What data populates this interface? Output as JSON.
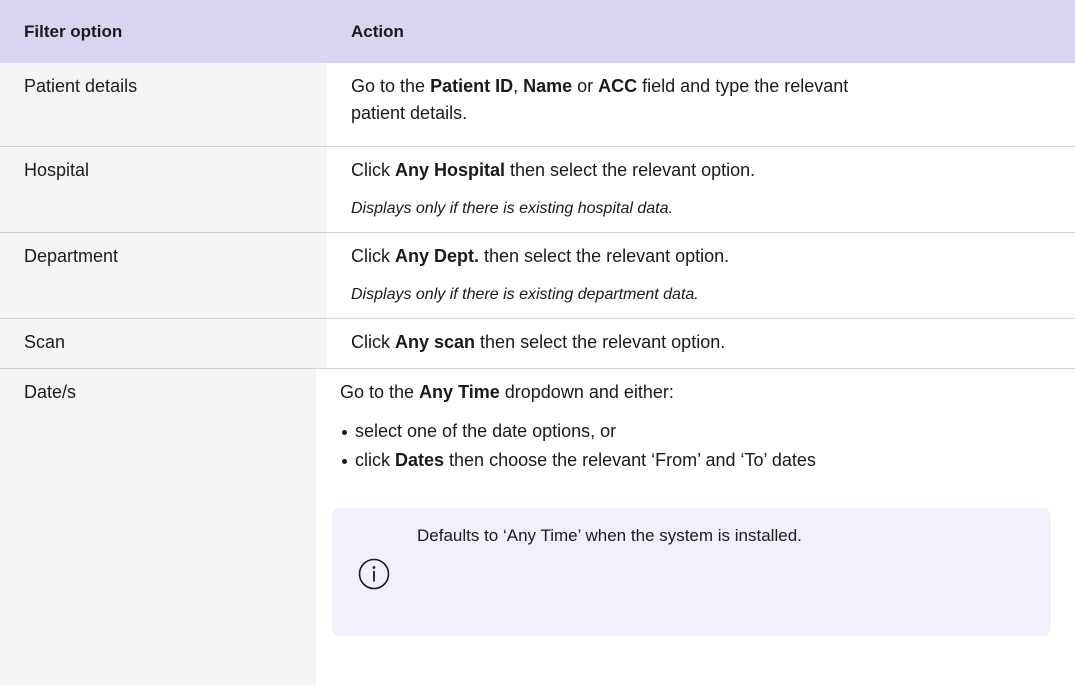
{
  "header": {
    "col1": "Filter option",
    "col2": "Action"
  },
  "rows": {
    "patient": {
      "option": "Patient details",
      "action_pre": "Go to the ",
      "b1": "Patient ID",
      "sep1": ", ",
      "b2": "Name",
      "sep2": " or ",
      "b3": "ACC",
      "action_post": " field and type the relevant",
      "action_line2": "patient details."
    },
    "hospital": {
      "option": "Hospital",
      "action_pre": "Click ",
      "bold": "Any Hospital",
      "action_post": " then select the relevant option.",
      "note": "Displays only if there is existing hospital data."
    },
    "department": {
      "option": "Department",
      "action_pre": "Click ",
      "bold": "Any Dept.",
      "action_post": " then select the relevant option.",
      "note": "Displays only if there is existing department data."
    },
    "scan": {
      "option": "Scan",
      "action_pre": "Click ",
      "bold": "Any scan",
      "action_post": " then select the relevant option."
    },
    "date": {
      "option": "Date/s",
      "action_pre": "Go to the ",
      "bold": "Any Time",
      "action_post": " dropdown and either:",
      "bullet1": "select one of the date options, or",
      "bullet2_pre": "click ",
      "bullet2_bold": "Dates",
      "bullet2_post": " then choose the relevant ‘From’ and ‘To’ dates",
      "info_icon": "info-icon",
      "info_text": "Defaults to ‘Any Time’ when the system is installed."
    }
  },
  "colors": {
    "header_bg": "#d9d4f2",
    "first_col_bg": "#f5f5f5",
    "callout_bg": "#f1f0fb",
    "divider": "#d4d4d4"
  }
}
